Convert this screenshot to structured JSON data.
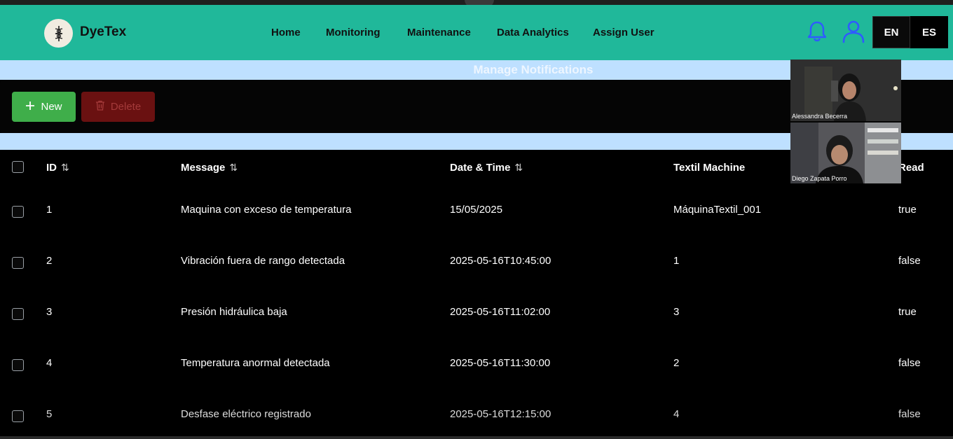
{
  "app": {
    "brand": "DyeTex"
  },
  "nav": {
    "links": [
      "Home",
      "Monitoring",
      "Maintenance",
      "Data Analytics",
      "Assign User"
    ],
    "lang_en": "EN",
    "lang_es": "ES"
  },
  "page": {
    "title": "Manage Notifications"
  },
  "toolbar": {
    "new_label": "New",
    "delete_label": "Delete"
  },
  "table": {
    "headers": {
      "id": "ID",
      "message": "Message",
      "datetime": "Date & Time",
      "machine": "Textil Machine",
      "read": "Read"
    },
    "sort_icon": "⇅",
    "rows": [
      {
        "id": "1",
        "message": "Maquina con exceso de temperatura",
        "datetime": "15/05/2025",
        "machine": "MáquinaTextil_001",
        "read": "true"
      },
      {
        "id": "2",
        "message": "Vibración fuera de rango detectada",
        "datetime": "2025-05-16T10:45:00",
        "machine": "1",
        "read": "false"
      },
      {
        "id": "3",
        "message": "Presión hidráulica baja",
        "datetime": "2025-05-16T11:02:00",
        "machine": "3",
        "read": "true"
      },
      {
        "id": "4",
        "message": "Temperatura anormal detectada",
        "datetime": "2025-05-16T11:30:00",
        "machine": "2",
        "read": "false"
      },
      {
        "id": "5",
        "message": "Desfase eléctrico registrado",
        "datetime": "2025-05-16T12:15:00",
        "machine": "4",
        "read": "false"
      }
    ]
  },
  "video_call": {
    "participants": [
      "Alessandra Becerra",
      "Diego Zapata Porro"
    ]
  },
  "colors": {
    "navbar": "#20b89a",
    "band": "#bee0ff",
    "new_button": "#3fae4a",
    "delete_button": "#6a1111",
    "icon_blue": "#2f5bff"
  }
}
